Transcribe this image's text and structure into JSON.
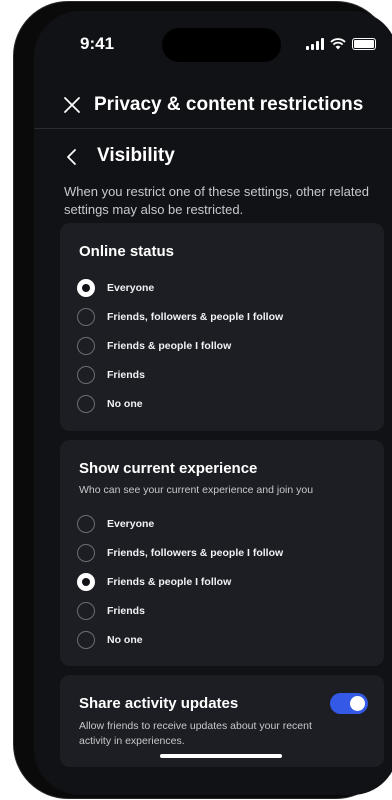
{
  "status_bar": {
    "time": "9:41"
  },
  "header": {
    "title": "Privacy & content restrictions"
  },
  "section": {
    "title": "Visibility",
    "description": "When you restrict one of these settings, other related settings may also be restricted."
  },
  "online_status": {
    "title": "Online status",
    "selected": "Everyone",
    "options": [
      {
        "label": "Everyone",
        "selected": true
      },
      {
        "label": "Friends, followers & people I follow",
        "selected": false
      },
      {
        "label": "Friends & people I follow",
        "selected": false
      },
      {
        "label": "Friends",
        "selected": false
      },
      {
        "label": "No one",
        "selected": false
      }
    ]
  },
  "current_experience": {
    "title": "Show current experience",
    "subtitle": "Who can see your current experience and join you",
    "selected": "Friends & people I follow",
    "options": [
      {
        "label": "Everyone",
        "selected": false
      },
      {
        "label": "Friends, followers & people I follow",
        "selected": false
      },
      {
        "label": "Friends & people I follow",
        "selected": true
      },
      {
        "label": "Friends",
        "selected": false
      },
      {
        "label": "No one",
        "selected": false
      }
    ]
  },
  "activity_updates": {
    "title": "Share activity updates",
    "subtitle": "Allow friends to receive updates about your recent activity in experiences.",
    "enabled": true
  },
  "colors": {
    "background": "#111216",
    "card": "#1d1e23",
    "accent": "#3359e6",
    "text": "#f1f2f4",
    "muted_text": "#c7c8cc"
  },
  "icons": {
    "close": "close-icon",
    "back": "chevron-left-icon",
    "signal": "cellular-signal-icon",
    "wifi": "wifi-icon",
    "battery": "battery-icon"
  }
}
